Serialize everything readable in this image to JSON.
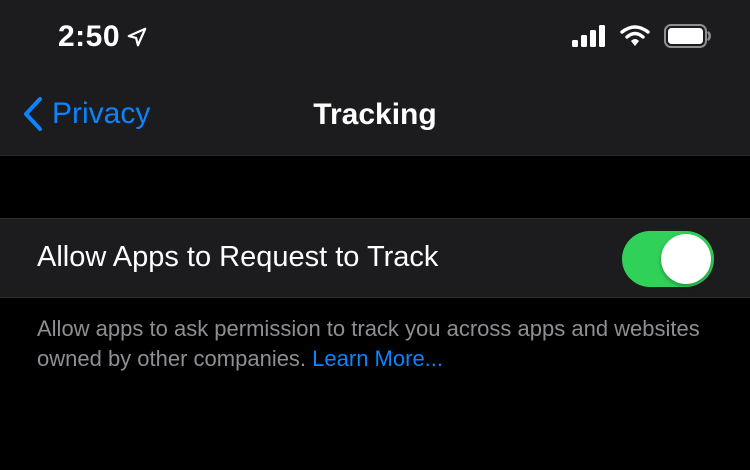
{
  "status_bar": {
    "time": "2:50",
    "icons": [
      "location-arrow-icon",
      "signal-icon",
      "wifi-icon",
      "battery-icon"
    ]
  },
  "nav": {
    "back_label": "Privacy",
    "title": "Tracking"
  },
  "setting": {
    "label": "Allow Apps to Request to Track",
    "toggle_on": true
  },
  "footer": {
    "description": "Allow apps to ask permission to track you across apps and websites owned by other companies. ",
    "link_label": "Learn More..."
  },
  "colors": {
    "accent": "#0a84ff",
    "toggle_on": "#30d158",
    "background": "#000000",
    "surface": "#1c1c1e",
    "secondary_text": "#8e8e93"
  }
}
